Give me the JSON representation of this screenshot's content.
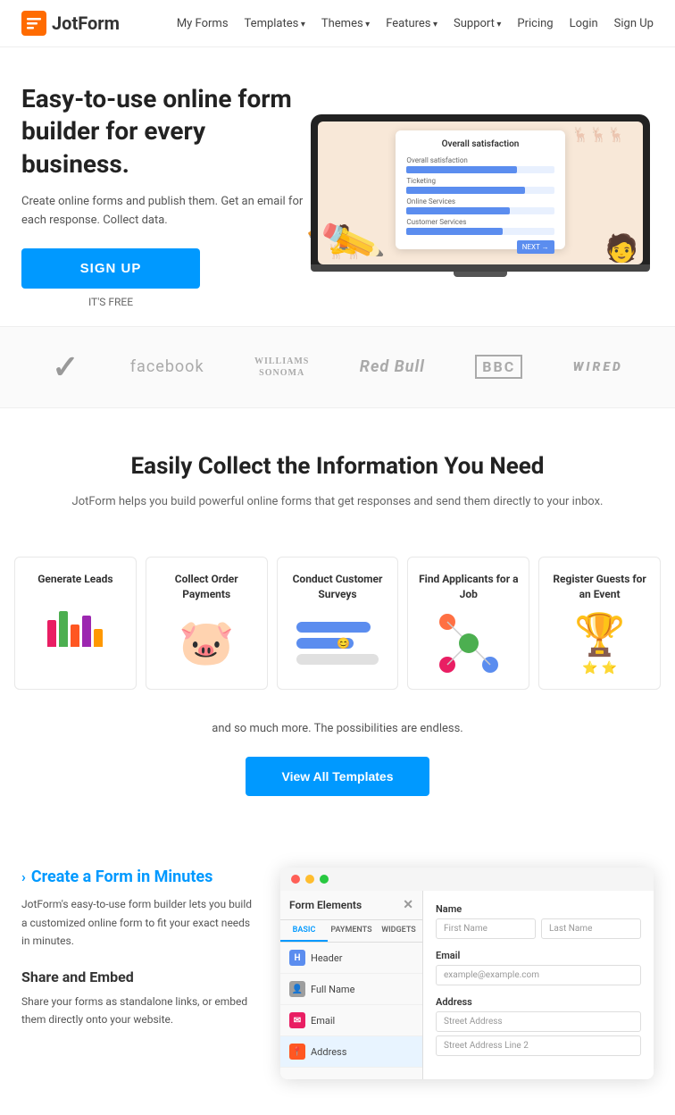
{
  "nav": {
    "logo_text": "JotForm",
    "links": [
      {
        "label": "My Forms",
        "has_arrow": false
      },
      {
        "label": "Templates",
        "has_arrow": true
      },
      {
        "label": "Themes",
        "has_arrow": true
      },
      {
        "label": "Features",
        "has_arrow": true
      },
      {
        "label": "Support",
        "has_arrow": true
      },
      {
        "label": "Pricing",
        "has_arrow": false
      },
      {
        "label": "Login",
        "has_arrow": false
      },
      {
        "label": "Sign Up",
        "has_arrow": false
      }
    ]
  },
  "hero": {
    "heading": "Easy-to-use online form builder for every business.",
    "subtext": "Create online forms and publish them.\nGet an email for each response. Collect data.",
    "cta_button": "SIGN UP",
    "cta_sub": "IT'S FREE",
    "survey_title": "Overall satisfaction",
    "survey_rows": [
      {
        "label": "Overall satisfaction",
        "width": "75"
      },
      {
        "label": "Ticketing",
        "width": "80"
      },
      {
        "label": "Online Services",
        "width": "70"
      },
      {
        "label": "Customer Services",
        "width": "65"
      }
    ],
    "survey_next": "NEXT →"
  },
  "brands": [
    {
      "name": "Nike",
      "type": "nike"
    },
    {
      "name": "facebook",
      "type": "facebook"
    },
    {
      "name": "WILLIAMS\nSONOMA",
      "type": "ws"
    },
    {
      "name": "Red Bull",
      "type": "redbull"
    },
    {
      "name": "BBC",
      "type": "bbc"
    },
    {
      "name": "WIRED",
      "type": "wired"
    }
  ],
  "info": {
    "heading": "Easily Collect the Information You Need",
    "subtext": "JotForm helps you build powerful online forms that get responses\nand send them directly to your inbox."
  },
  "cards": [
    {
      "title": "Generate Leads",
      "type": "hands"
    },
    {
      "title": "Collect Order Payments",
      "type": "piggy"
    },
    {
      "title": "Conduct Customer Surveys",
      "type": "survey"
    },
    {
      "title": "Find Applicants for a Job",
      "type": "network"
    },
    {
      "title": "Register Guests for an Event",
      "type": "trophy"
    }
  ],
  "more": {
    "text": "and so much more. The possibilities are endless.",
    "view_all": "View All Templates"
  },
  "bottom": {
    "create_title": "Create a Form in Minutes",
    "create_desc": "JotForm's easy-to-use form builder lets you build a customized online form to fit your exact needs in minutes.",
    "share_title": "Share and Embed",
    "share_desc": "Share your forms as standalone links, or embed them directly onto your website.",
    "form_builder_title": "Form Elements",
    "tabs": [
      "BASIC",
      "PAYMENTS",
      "WIDGETS"
    ],
    "items": [
      "Header",
      "Full Name",
      "Email",
      "Address"
    ],
    "fields": [
      {
        "label": "Name",
        "inputs": [
          "First Name",
          "Last Name"
        ]
      },
      {
        "label": "Email",
        "inputs": [
          "example@example.com"
        ]
      },
      {
        "label": "Address",
        "inputs": [
          "Street Address",
          "Street Address Line 2"
        ]
      }
    ]
  },
  "colors": {
    "primary": "#0099ff",
    "accent": "#ff8c00"
  }
}
